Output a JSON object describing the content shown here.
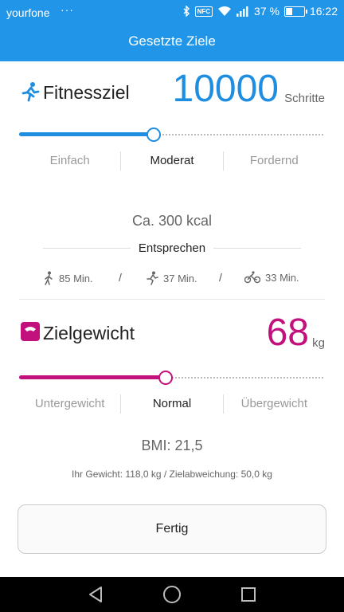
{
  "status_bar": {
    "carrier": "yourfone",
    "notif_dots": "···",
    "nfc_label": "NFC",
    "battery_percent": "37 %",
    "battery_level": 0.37,
    "time": "16:22"
  },
  "header": {
    "title": "Gesetzte Ziele"
  },
  "fitness": {
    "label": "Fitnessziel",
    "value": "10000",
    "unit": "Schritte",
    "slider_level": 0.44,
    "levels": [
      "Einfach",
      "Moderat",
      "Fordernd"
    ],
    "active_level": 1,
    "kcal": "Ca. 300 kcal",
    "equivalent_label": "Entsprechen",
    "activities": [
      {
        "icon": "walking-icon",
        "text": "85 Min."
      },
      {
        "icon": "running-icon",
        "text": "37 Min."
      },
      {
        "icon": "cycling-icon",
        "text": "33 Min."
      }
    ],
    "separator": "/",
    "accent": "#1f8ee0"
  },
  "weight": {
    "label": "Zielgewicht",
    "value": "68",
    "unit": "kg",
    "slider_level": 0.48,
    "levels": [
      "Untergewicht",
      "Normal",
      "Übergewicht"
    ],
    "active_level": 1,
    "bmi": "BMI: 21,5",
    "info": "Ihr Gewicht: 118,0 kg / Zielabweichung: 50,0 kg",
    "accent": "#c2117d"
  },
  "done_button": "Fertig",
  "nav": {
    "icons": [
      "back-icon",
      "home-icon",
      "recents-icon"
    ]
  },
  "colors": {
    "header": "#2196e8",
    "fitness_accent": "#1f8ee0",
    "weight_accent": "#c2117d"
  }
}
